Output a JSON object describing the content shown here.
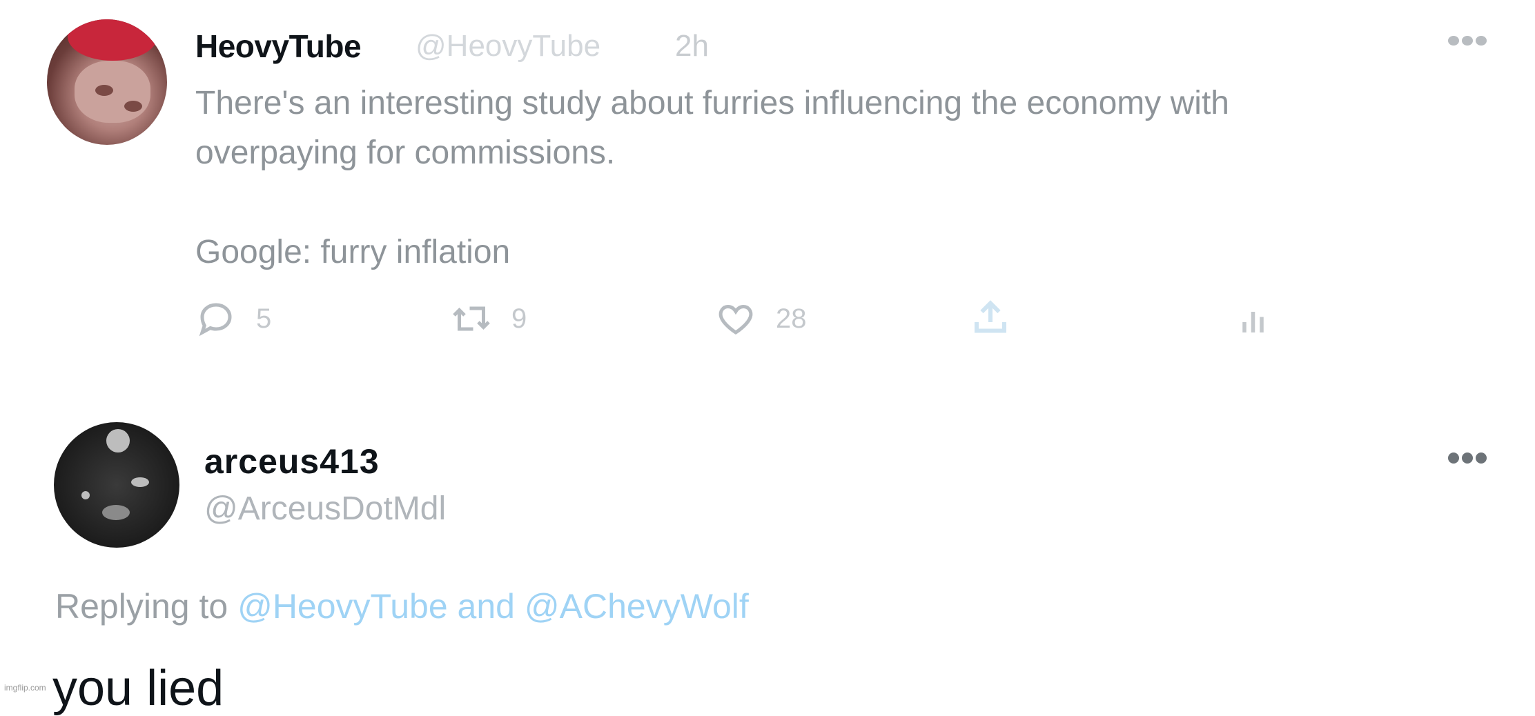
{
  "tweet1": {
    "display_name": "HeovyTube",
    "handle": "@HeovyTube",
    "time": "2h",
    "body": "There's an interesting study about furries influencing the economy with\noverpaying for commissions.\n\nGoogle: furry inflation",
    "replies": "5",
    "retweets": "9",
    "likes": "28",
    "icons": {
      "reply": "reply-icon",
      "retweet": "retweet-icon",
      "like": "heart-icon",
      "share": "share-icon",
      "analytics": "analytics-icon",
      "more": "more-icon"
    },
    "share_color": "#cfe4f2"
  },
  "tweet2": {
    "display_name": "arceus413",
    "handle": "@ArceusDotMdl",
    "replying_prefix": "Replying to",
    "replying_mentions": "@HeovyTube and @AChevyWolf",
    "text": "you lied",
    "mention_color": "#9fd3f5"
  },
  "watermark": "imgflip.com"
}
